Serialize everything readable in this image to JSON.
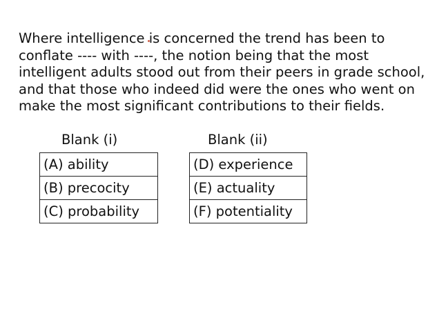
{
  "passage": {
    "lines": [
      "Where intelligence is concerned the trend has been to",
      "conflate ---- with ----, the notion being that the most",
      "intelligent adults stood out from their peers in grade school,",
      "and that those who indeed did were the ones who went on",
      "make the most significant contributions to their fields."
    ]
  },
  "blanks": [
    {
      "title": "Blank (i)",
      "options": [
        "(A) ability",
        "(B) precocity",
        "(C) probability"
      ]
    },
    {
      "title": "Blank (ii)",
      "options": [
        "(D) experience",
        "(E) actuality",
        "(F) potentiality"
      ]
    }
  ],
  "colors": {
    "text": "#111111",
    "border": "#222222",
    "background": "#ffffff",
    "cursor": "#d0604a"
  }
}
